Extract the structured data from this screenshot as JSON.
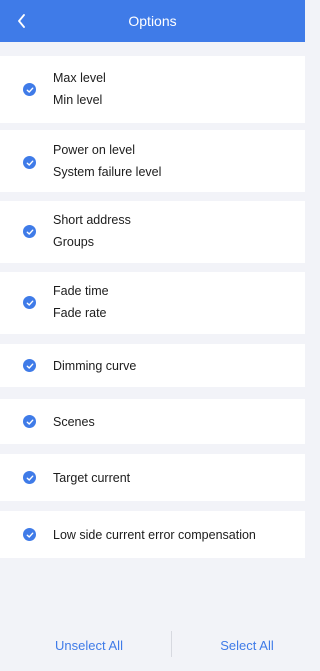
{
  "header": {
    "title": "Options",
    "back_icon": "chevron-left-icon"
  },
  "colors": {
    "accent": "#3f7be8",
    "background": "#f2f3f8",
    "card": "#ffffff",
    "text": "#1c1c1c"
  },
  "options": [
    {
      "lines": [
        "Max level",
        "Min level"
      ],
      "selected": true
    },
    {
      "lines": [
        "Power on level",
        "System failure level"
      ],
      "selected": true
    },
    {
      "lines": [
        "Short address",
        "Groups"
      ],
      "selected": true
    },
    {
      "lines": [
        "Fade time",
        "Fade rate"
      ],
      "selected": true
    },
    {
      "lines": [
        "Dimming curve"
      ],
      "selected": true
    },
    {
      "lines": [
        "Scenes"
      ],
      "selected": true
    },
    {
      "lines": [
        "Target current"
      ],
      "selected": true
    },
    {
      "lines": [
        "Low side current error compensation"
      ],
      "selected": true
    }
  ],
  "footer": {
    "unselect_all_label": "Unselect All",
    "select_all_label": "Select All"
  }
}
